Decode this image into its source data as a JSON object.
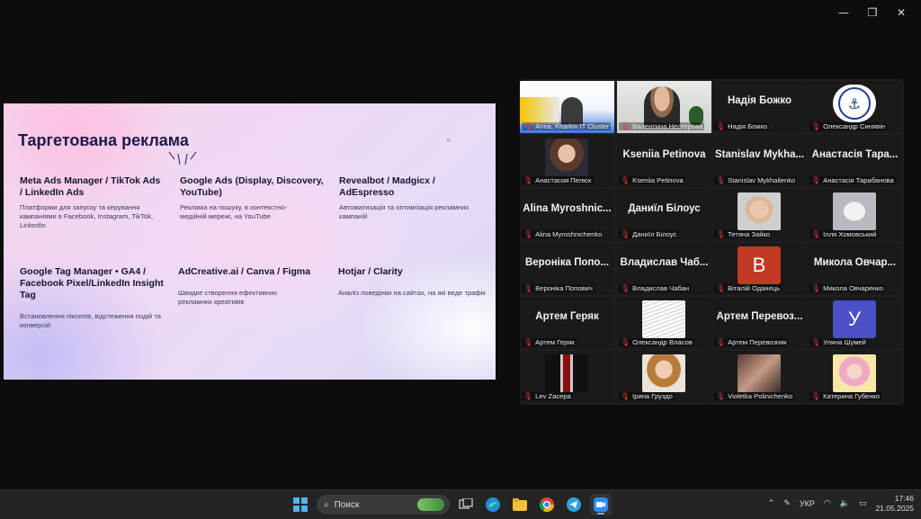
{
  "window_controls": {
    "minimize": "—",
    "restore": "❐",
    "close": "✕"
  },
  "slide": {
    "title": "Таргетована реклама",
    "cells": [
      {
        "heading": "Meta Ads Manager / TikTok Ads / LinkedIn Ads",
        "desc": "Платформи для запуску та керування кампаніями в Facebook, Instagram, TikTok, LinkedIn"
      },
      {
        "heading": "Google Ads (Display, Discovery, YouTube)",
        "desc": "Реклама на пошуку, в контекстно-медійній мережі, на YouTube"
      },
      {
        "heading": "Revealbot / Madgicx / AdEspresso",
        "desc": "Автоматизація та оптимізація рекламних кампаній"
      },
      {
        "heading": "Google Tag Manager • GA4 / Facebook Pixel/LinkedIn Insight Tag",
        "desc": "Встановлення пікселів, відстеження подій та конверсій"
      },
      {
        "heading": "AdCreative.ai / Canva / Figma",
        "desc": "Швидке створення ефективних рекламних креативів"
      },
      {
        "heading": "Hotjar / Clarity",
        "desc": "Аналіз поведінки на сайтах, на які веде трафік"
      }
    ]
  },
  "participants": [
    {
      "name": "Anna, Kharkiv IT Cluster",
      "big": "",
      "kind": "share",
      "active": false
    },
    {
      "name": "Валентина Нестерова",
      "big": "",
      "kind": "video",
      "active": true
    },
    {
      "name": "Надія Божко",
      "big": "Надія Божко",
      "kind": "name",
      "active": false
    },
    {
      "name": "Олександр Синявін",
      "big": "",
      "kind": "logo",
      "active": false
    },
    {
      "name": "Анастасия Пелюх",
      "big": "",
      "kind": "photo",
      "active": false
    },
    {
      "name": "Kseniia Petinova",
      "big": "Kseniia Petinova",
      "kind": "name",
      "active": false
    },
    {
      "name": "Stanislav Mykhailenko",
      "big": "Stanislav Mykha...",
      "kind": "name",
      "active": false
    },
    {
      "name": "Анастасія Тарабанова",
      "big": "Анастасія Тара...",
      "kind": "name",
      "active": false
    },
    {
      "name": "Alina Myroshnichenko",
      "big": "Alina Myroshnic...",
      "kind": "name",
      "active": false
    },
    {
      "name": "Даниїл Білоус",
      "big": "Даниїл Білоус",
      "kind": "name",
      "active": false
    },
    {
      "name": "Тетяна Зайко",
      "big": "",
      "kind": "photo",
      "active": false
    },
    {
      "name": "Ілля Хомовський",
      "big": "",
      "kind": "photo",
      "active": false
    },
    {
      "name": "Вероніка Попович",
      "big": "Вероніка Попо...",
      "kind": "name",
      "active": false
    },
    {
      "name": "Владислав Чабан",
      "big": "Владислав Чаб...",
      "kind": "name",
      "active": false
    },
    {
      "name": "Віталій Оданець",
      "big": "",
      "kind": "letter",
      "letter": "B",
      "color": "#c23a22",
      "active": false
    },
    {
      "name": "Микола Овчаренко",
      "big": "Микола Овчар...",
      "kind": "name",
      "active": false
    },
    {
      "name": "Артем Геряк",
      "big": "Артем Геряк",
      "kind": "name",
      "active": false
    },
    {
      "name": "Олександр Власов",
      "big": "",
      "kind": "photo",
      "active": false
    },
    {
      "name": "Артем Перевозняк",
      "big": "Артем Перевоз...",
      "kind": "name",
      "active": false
    },
    {
      "name": "Уляна Шумей",
      "big": "",
      "kind": "letter",
      "letter": "У",
      "color": "#4b4fc8",
      "active": false
    },
    {
      "name": "Lev Zacepa",
      "big": "",
      "kind": "photo",
      "active": false
    },
    {
      "name": "Ірина Груздо",
      "big": "",
      "kind": "photo",
      "active": false
    },
    {
      "name": "Violetka Polinichenko",
      "big": "",
      "kind": "photo",
      "active": false
    },
    {
      "name": "Катерина Губенко",
      "big": "",
      "kind": "photo",
      "active": false
    }
  ],
  "taskbar": {
    "search_placeholder": "Поиск",
    "icons": [
      "windows-start-icon",
      "task-view-icon",
      "edge-icon",
      "file-explorer-icon",
      "chrome-icon",
      "telegram-icon",
      "zoom-icon"
    ],
    "language": "УКР",
    "time": "17:46",
    "date": "21.05.2025"
  }
}
